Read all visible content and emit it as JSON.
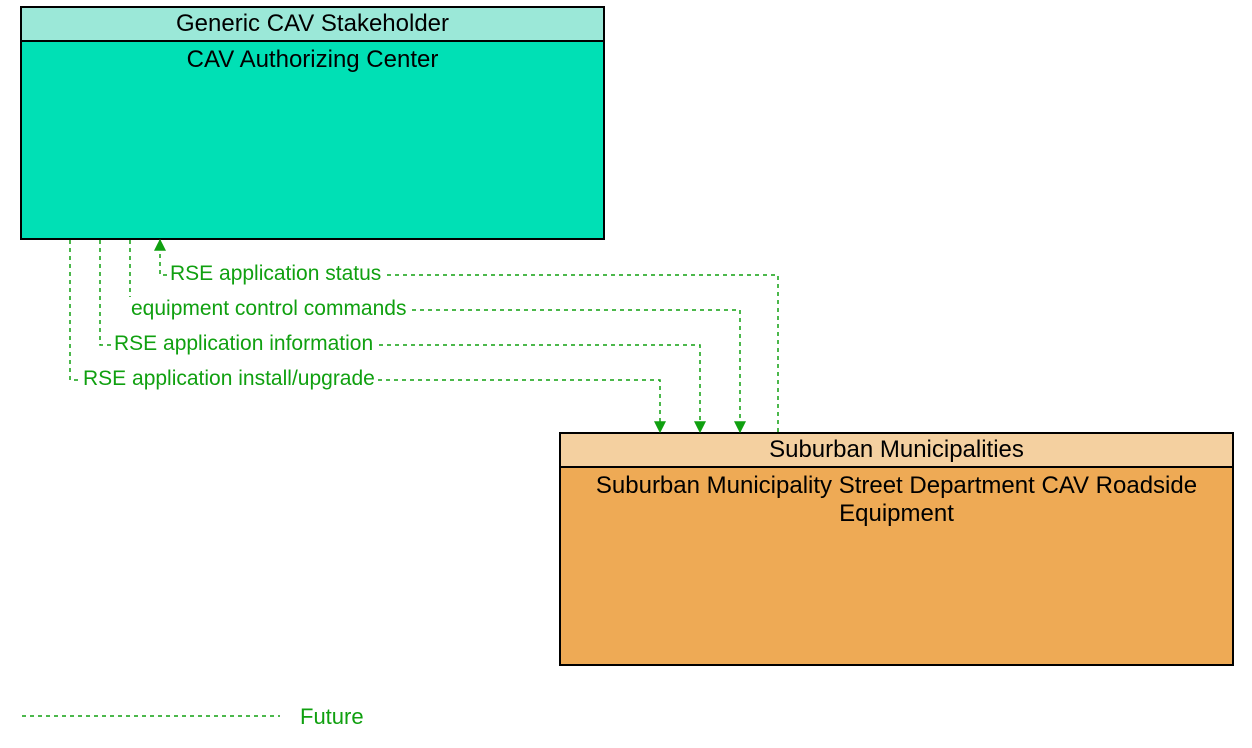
{
  "nodes": {
    "top": {
      "header": "Generic CAV Stakeholder",
      "body": "CAV Authorizing Center",
      "header_fill": "#9be8d8",
      "body_fill": "#00e0b5"
    },
    "bottom": {
      "header": "Suburban Municipalities",
      "body": "Suburban Municipality Street Department CAV Roadside Equipment",
      "header_fill": "#f4d0a0",
      "body_fill": "#eeaa55"
    }
  },
  "flows": {
    "f1": "RSE application status",
    "f2": "equipment control commands",
    "f3": "RSE application information",
    "f4": "RSE application install/upgrade"
  },
  "legend": {
    "future": "Future"
  },
  "colors": {
    "flow_line": "#10a010"
  }
}
